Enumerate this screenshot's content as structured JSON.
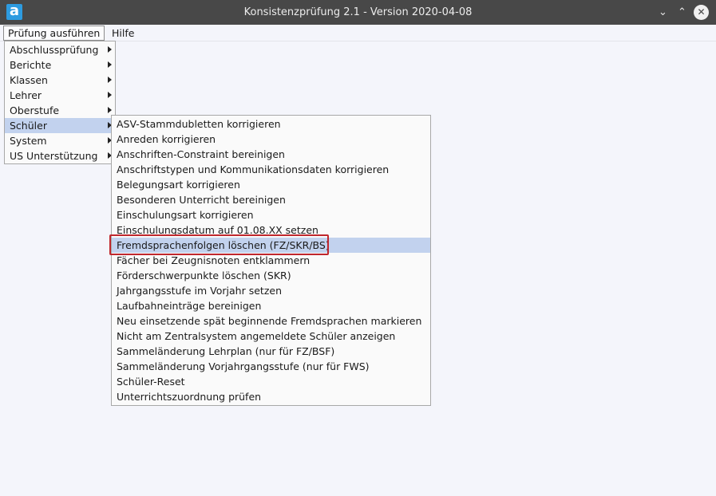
{
  "window": {
    "title": "Konsistenzprüfung 2.1 - Version 2020-04-08",
    "logo_letter": "a",
    "minimize_glyph": "⌄",
    "maximize_glyph": "⌃",
    "close_glyph": "✕"
  },
  "menubar": {
    "items": [
      {
        "label": "Prüfung ausführen",
        "active": true
      },
      {
        "label": "Hilfe",
        "active": false
      }
    ]
  },
  "main_menu": {
    "items": [
      {
        "label": "Abschlussprüfung",
        "submenu": true
      },
      {
        "label": "Berichte",
        "submenu": true
      },
      {
        "label": "Klassen",
        "submenu": true
      },
      {
        "label": "Lehrer",
        "submenu": true
      },
      {
        "label": "Oberstufe",
        "submenu": true
      },
      {
        "label": "Schüler",
        "submenu": true,
        "selected": true
      },
      {
        "label": "System",
        "submenu": true
      },
      {
        "label": "US Unterstützung",
        "submenu": true
      }
    ]
  },
  "schueler_submenu": {
    "items": [
      {
        "label": "ASV-Stammdubletten korrigieren"
      },
      {
        "label": "Anreden korrigieren"
      },
      {
        "label": "Anschriften-Constraint bereinigen"
      },
      {
        "label": "Anschriftstypen und Kommunikationsdaten korrigieren"
      },
      {
        "label": "Belegungsart korrigieren"
      },
      {
        "label": "Besonderen Unterricht bereinigen"
      },
      {
        "label": "Einschulungsart korrigieren"
      },
      {
        "label": "Einschulungsdatum auf 01.08.XX setzen"
      },
      {
        "label": "Fremdsprachenfolgen löschen (FZ/SKR/BS)",
        "selected": true,
        "highlighted": true
      },
      {
        "label": "Fächer bei Zeugnisnoten entklammern"
      },
      {
        "label": "Förderschwerpunkte löschen (SKR)"
      },
      {
        "label": "Jahrgangsstufe im Vorjahr setzen"
      },
      {
        "label": "Laufbahneinträge bereinigen"
      },
      {
        "label": "Neu einsetzende spät beginnende Fremdsprachen markieren"
      },
      {
        "label": "Nicht am Zentralsystem angemeldete Schüler anzeigen"
      },
      {
        "label": "Sammeländerung Lehrplan (nur für FZ/BSF)"
      },
      {
        "label": "Sammeländerung Vorjahrgangsstufe (nur für FWS)"
      },
      {
        "label": "Schüler-Reset"
      },
      {
        "label": "Unterrichtszuordnung prüfen"
      }
    ]
  },
  "colors": {
    "titlebar": "#484848",
    "menu_selection": "#c2d2ee",
    "highlight_box": "#c0272d",
    "logo": "#2d9be0"
  }
}
